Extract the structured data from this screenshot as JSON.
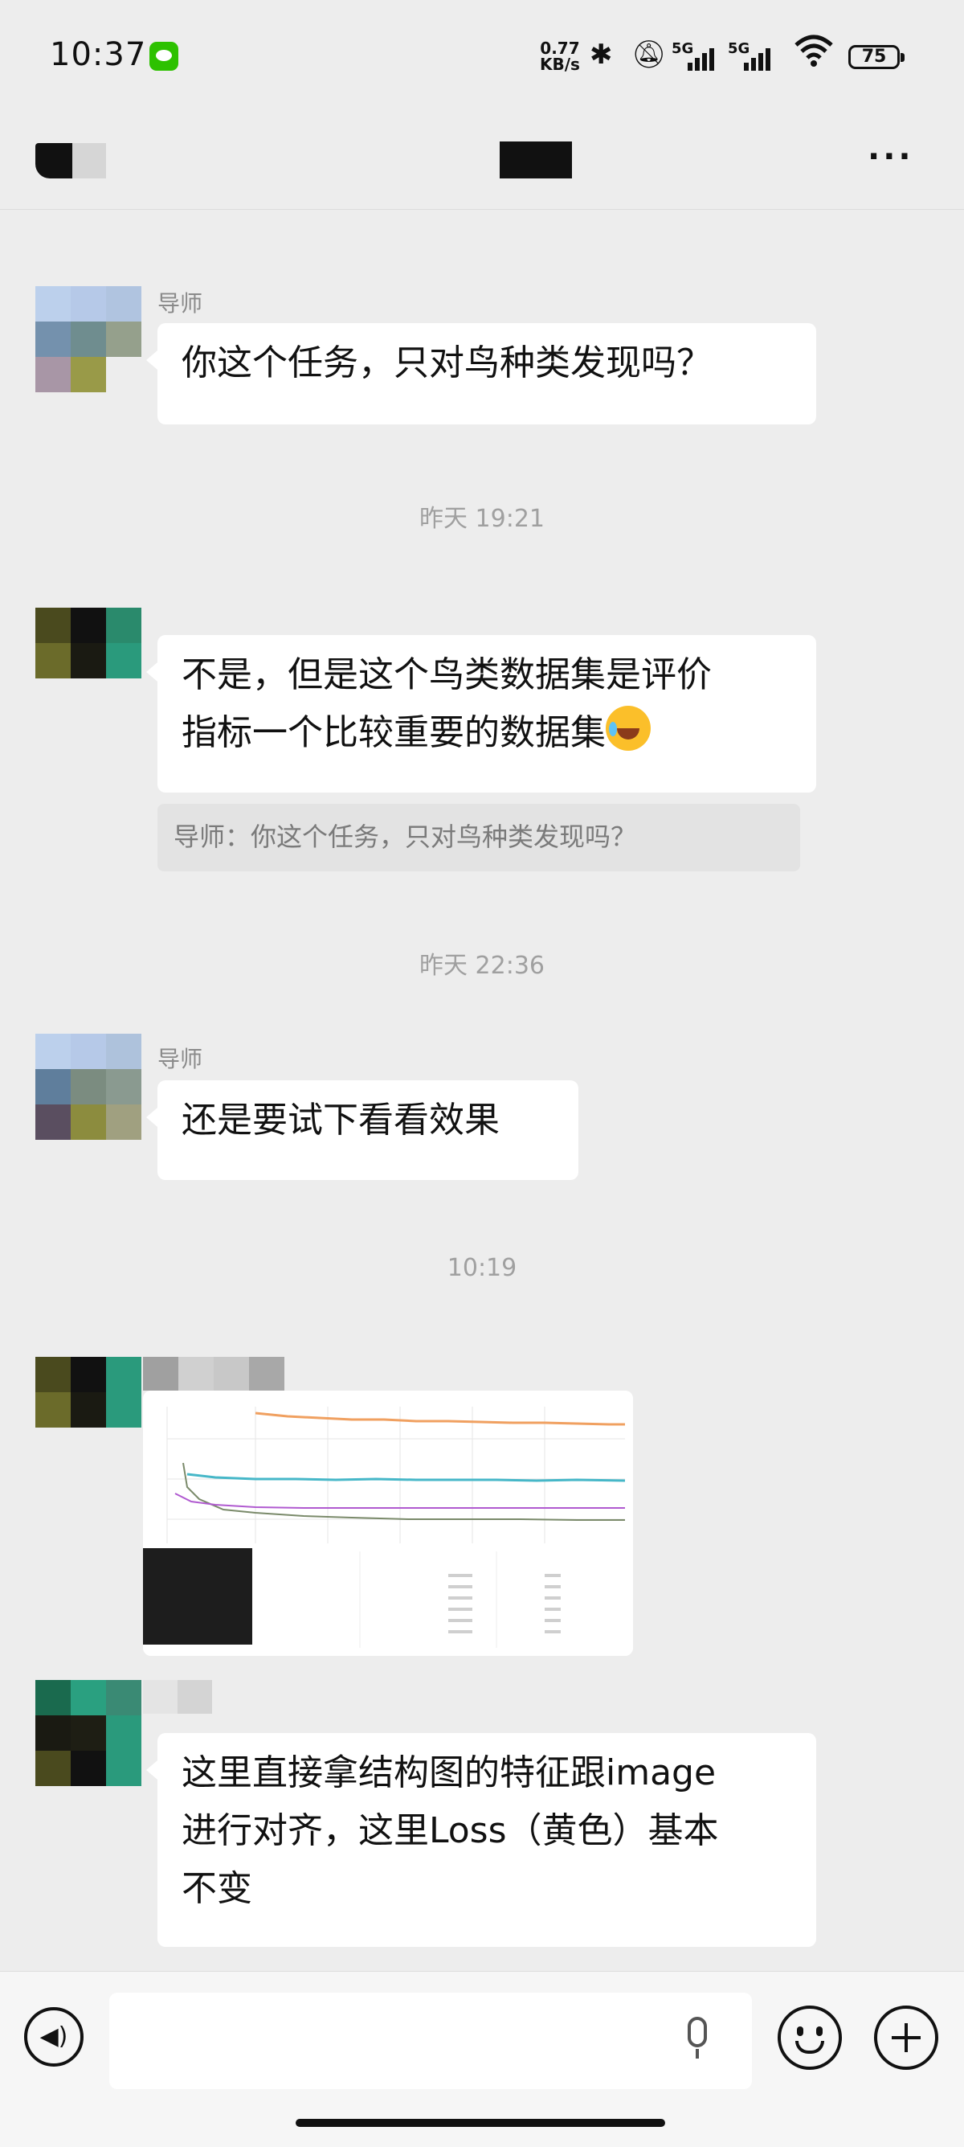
{
  "status_bar": {
    "time": "10:37",
    "net_speed_value": "0.77",
    "net_speed_unit": "KB/s",
    "signal1": "5G",
    "signal2": "5G",
    "battery": "75"
  },
  "header": {
    "more_label": "···"
  },
  "messages": [
    {
      "sender": "导师",
      "text": "你这个任务，只对鸟种类发现吗？"
    },
    {
      "timestamp": "昨天 19:21"
    },
    {
      "text_line1": "不是，但是这个鸟类数据集是评价",
      "text_line2": "指标一个比较重要的数据集",
      "quote": "导师：你这个任务，只对鸟种类发现吗？"
    },
    {
      "timestamp": "昨天 22:36"
    },
    {
      "sender": "导师",
      "text": "还是要试下看看效果"
    },
    {
      "timestamp": "10:19"
    },
    {
      "image": "loss-chart-screenshot"
    },
    {
      "text_line1": "这里直接拿结构图的特征跟image",
      "text_line2": "进行对齐，这里Loss（黄色）基本",
      "text_line3": "不变"
    }
  ],
  "input_bar": {
    "placeholder": ""
  },
  "colors": {
    "background": "#ededed",
    "bubble": "#ffffff",
    "wechat_green": "#2dc100"
  }
}
